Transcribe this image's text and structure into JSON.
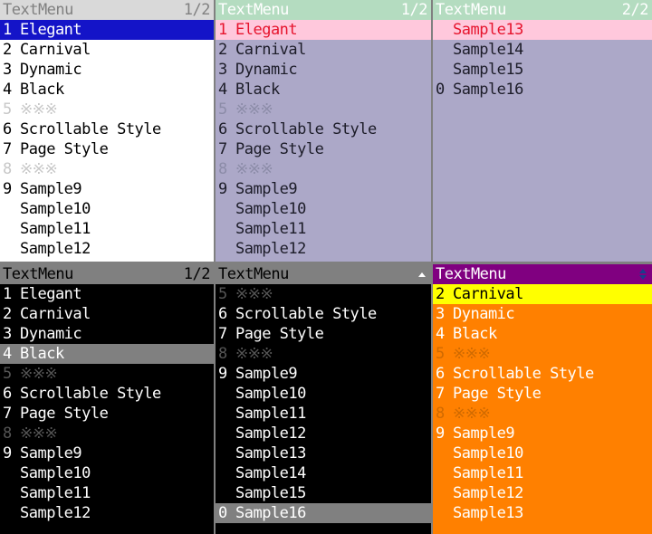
{
  "panels": [
    {
      "id": "default-style",
      "theme": "t-default",
      "header": {
        "title": "TextMenu",
        "page": "1/2",
        "arrow": "none"
      },
      "rows": [
        {
          "key": "1",
          "label": "Elegant",
          "state": "selected"
        },
        {
          "key": "2",
          "label": "Carnival",
          "state": "normal"
        },
        {
          "key": "3",
          "label": "Dynamic",
          "state": "normal"
        },
        {
          "key": "4",
          "label": "Black",
          "state": "normal"
        },
        {
          "key": "5",
          "label": "※※※",
          "state": "disabled"
        },
        {
          "key": "6",
          "label": "Scrollable Style",
          "state": "normal"
        },
        {
          "key": "7",
          "label": "Page Style",
          "state": "normal"
        },
        {
          "key": "8",
          "label": "※※※",
          "state": "disabled"
        },
        {
          "key": "9",
          "label": "Sample9",
          "state": "normal"
        },
        {
          "key": "",
          "label": "Sample10",
          "state": "normal"
        },
        {
          "key": "",
          "label": "Sample11",
          "state": "normal"
        },
        {
          "key": "",
          "label": "Sample12",
          "state": "normal"
        }
      ]
    },
    {
      "id": "elegant-style-page1",
      "theme": "t-elegant",
      "header": {
        "title": "TextMenu",
        "page": "1/2",
        "arrow": "none"
      },
      "rows": [
        {
          "key": "1",
          "label": "Elegant",
          "state": "selected"
        },
        {
          "key": "2",
          "label": "Carnival",
          "state": "normal"
        },
        {
          "key": "3",
          "label": "Dynamic",
          "state": "normal"
        },
        {
          "key": "4",
          "label": "Black",
          "state": "normal"
        },
        {
          "key": "5",
          "label": "※※※",
          "state": "disabled"
        },
        {
          "key": "6",
          "label": "Scrollable Style",
          "state": "normal"
        },
        {
          "key": "7",
          "label": "Page Style",
          "state": "normal"
        },
        {
          "key": "8",
          "label": "※※※",
          "state": "disabled"
        },
        {
          "key": "9",
          "label": "Sample9",
          "state": "normal"
        },
        {
          "key": "",
          "label": "Sample10",
          "state": "normal"
        },
        {
          "key": "",
          "label": "Sample11",
          "state": "normal"
        },
        {
          "key": "",
          "label": "Sample12",
          "state": "normal"
        }
      ]
    },
    {
      "id": "elegant-style-page2",
      "theme": "t-elegant",
      "header": {
        "title": "TextMenu",
        "page": "2/2",
        "arrow": "none"
      },
      "rows": [
        {
          "key": "",
          "label": "Sample13",
          "state": "selected"
        },
        {
          "key": "",
          "label": "Sample14",
          "state": "normal"
        },
        {
          "key": "",
          "label": "Sample15",
          "state": "normal"
        },
        {
          "key": "0",
          "label": "Sample16",
          "state": "normal"
        }
      ]
    },
    {
      "id": "black-style",
      "theme": "t-black",
      "header": {
        "title": "TextMenu",
        "page": "1/2",
        "arrow": "none"
      },
      "rows": [
        {
          "key": "1",
          "label": "Elegant",
          "state": "normal"
        },
        {
          "key": "2",
          "label": "Carnival",
          "state": "normal"
        },
        {
          "key": "3",
          "label": "Dynamic",
          "state": "normal"
        },
        {
          "key": "4",
          "label": "Black",
          "state": "selected"
        },
        {
          "key": "5",
          "label": "※※※",
          "state": "disabled"
        },
        {
          "key": "6",
          "label": "Scrollable Style",
          "state": "normal"
        },
        {
          "key": "7",
          "label": "Page Style",
          "state": "normal"
        },
        {
          "key": "8",
          "label": "※※※",
          "state": "disabled"
        },
        {
          "key": "9",
          "label": "Sample9",
          "state": "normal"
        },
        {
          "key": "",
          "label": "Sample10",
          "state": "normal"
        },
        {
          "key": "",
          "label": "Sample11",
          "state": "normal"
        },
        {
          "key": "",
          "label": "Sample12",
          "state": "normal"
        }
      ]
    },
    {
      "id": "scrollable-style-bottom",
      "theme": "t-black",
      "header": {
        "title": "TextMenu",
        "page": "",
        "arrow": "up"
      },
      "rows": [
        {
          "key": "5",
          "label": "※※※",
          "state": "disabled"
        },
        {
          "key": "6",
          "label": "Scrollable Style",
          "state": "normal"
        },
        {
          "key": "7",
          "label": "Page Style",
          "state": "normal"
        },
        {
          "key": "8",
          "label": "※※※",
          "state": "disabled"
        },
        {
          "key": "9",
          "label": "Sample9",
          "state": "normal"
        },
        {
          "key": "",
          "label": "Sample10",
          "state": "normal"
        },
        {
          "key": "",
          "label": "Sample11",
          "state": "normal"
        },
        {
          "key": "",
          "label": "Sample12",
          "state": "normal"
        },
        {
          "key": "",
          "label": "Sample13",
          "state": "normal"
        },
        {
          "key": "",
          "label": "Sample14",
          "state": "normal"
        },
        {
          "key": "",
          "label": "Sample15",
          "state": "normal"
        },
        {
          "key": "0",
          "label": "Sample16",
          "state": "selected"
        }
      ]
    },
    {
      "id": "carnival-style",
      "theme": "t-carnival",
      "header": {
        "title": "TextMenu",
        "page": "",
        "arrow": "updown"
      },
      "rows": [
        {
          "key": "2",
          "label": "Carnival",
          "state": "selected"
        },
        {
          "key": "3",
          "label": "Dynamic",
          "state": "normal"
        },
        {
          "key": "4",
          "label": "Black",
          "state": "normal"
        },
        {
          "key": "5",
          "label": "※※※",
          "state": "disabled"
        },
        {
          "key": "6",
          "label": "Scrollable Style",
          "state": "normal"
        },
        {
          "key": "7",
          "label": "Page Style",
          "state": "normal"
        },
        {
          "key": "8",
          "label": "※※※",
          "state": "disabled"
        },
        {
          "key": "9",
          "label": "Sample9",
          "state": "normal"
        },
        {
          "key": "",
          "label": "Sample10",
          "state": "normal"
        },
        {
          "key": "",
          "label": "Sample11",
          "state": "normal"
        },
        {
          "key": "",
          "label": "Sample12",
          "state": "normal"
        },
        {
          "key": "",
          "label": "Sample13",
          "state": "normal"
        }
      ]
    }
  ],
  "colors": {
    "frame": "#808080",
    "default_header_bg": "#d9d9d9",
    "default_select_bg": "#1414c8",
    "elegant_header_bg": "#b4dcc0",
    "elegant_body_bg": "#aca8c8",
    "elegant_select_bg": "#ffc8dc",
    "elegant_select_fg": "#e6142d",
    "black_header_bg": "#808080",
    "black_body_bg": "#000000",
    "carnival_header_bg": "#800080",
    "carnival_body_bg": "#ff8000",
    "carnival_select_bg": "#ffff00"
  }
}
